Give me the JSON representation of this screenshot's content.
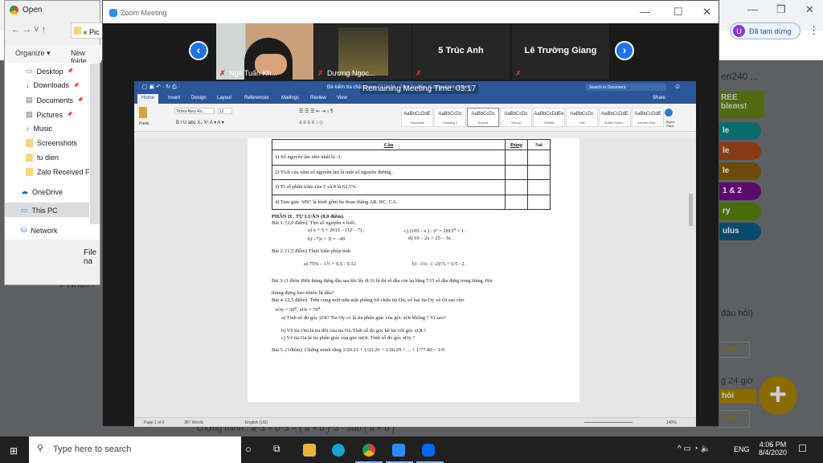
{
  "browser": {
    "profile_label": "Đã tạm dừng",
    "profile_initial": "U",
    "page_title_fragment": "en240 ...",
    "ad_lines": [
      "REE",
      "blems!"
    ],
    "pills": [
      {
        "label": "le",
        "color": "#0a6b6b"
      },
      {
        "label": "le",
        "color": "#8a3a14"
      },
      {
        "label": "le",
        "color": "#6b4a0a"
      },
      {
        "label": "1 & 2",
        "color": "#5a0a6b"
      },
      {
        "label": "ry",
        "color": "#4a6b0a"
      },
      {
        "label": "ulus",
        "color": "#0a4a6b"
      }
    ],
    "question_fragment": "đâu hỏi)",
    "reply_fragment": "c đầu",
    "time_fragment": "g 24 giờ",
    "ask_fragment": "hỏi",
    "reply_fragment2": "c đầu",
    "music_fragment": "♪ Nhạc l",
    "behind_text": "chưng minh : a^3 + b^3 = ( a + b )^3 - 3ab ( a + b )"
  },
  "open_dialog": {
    "title": "Open",
    "path": "« Pic",
    "organize": "Organize ▾",
    "new_folder": "New folde",
    "items": [
      "Desktop",
      "Downloads",
      "Documents",
      "Pictures",
      "Music",
      "Screenshots",
      "tu dien",
      "Zalo Received Fi"
    ],
    "onedrive": "OneDrive",
    "this_pc": "This PC",
    "network": "Network",
    "file_name_label": "File na"
  },
  "zoom": {
    "title": "Zoom Meeting",
    "participants": [
      {
        "name": "Ngô Tuấn Kh...",
        "video": true
      },
      {
        "name": "Dương Ngọc...",
        "video": true
      },
      {
        "name": "",
        "center": "5 Trúc Anh"
      },
      {
        "name": "",
        "center": "Lê Trường Giang"
      }
    ],
    "remaining": "Remaining Meeting Time: 03:17"
  },
  "word": {
    "title": "Đề kiểm tra chất lượng T7 2020 - Tâm Trí Đức [Compatibility Mode]",
    "search_placeholder": "Search in Document",
    "tabs": [
      "Home",
      "Insert",
      "Design",
      "Layout",
      "References",
      "Mailings",
      "Review",
      "View"
    ],
    "share": "Share",
    "font": "Times New Ro...",
    "size": "12",
    "paste": "Paste",
    "styles": [
      {
        "sample": "AaBbCcDdE",
        "name": "Emphasis"
      },
      {
        "sample": "AaBbCcDc",
        "name": "Heading 1"
      },
      {
        "sample": "AaBbCcDc",
        "name": "Normal"
      },
      {
        "sample": "AaBbCcDc",
        "name": "Strong"
      },
      {
        "sample": "AaBbCcDdEe",
        "name": "Subtitle"
      },
      {
        "sample": "AaBbCcDc",
        "name": "Title"
      },
      {
        "sample": "AaBbCcDdE",
        "name": "Subtle Emph..."
      },
      {
        "sample": "AaBbCcDdE",
        "name": "Intense Emp..."
      }
    ],
    "styles_pane": "Styles Pane",
    "status": {
      "page": "Page 1 of 2",
      "words": "367 Words",
      "lang": "English (US)",
      "zoom": "140%"
    },
    "table": {
      "headers": [
        "Câu",
        "Đúng",
        "Sai"
      ],
      "rows": [
        "1) Số nguyên âm nhỏ nhất là -1.",
        "2) Tích của năm số nguyên âm là một số nguyên dương .",
        "3) Tỉ số phần trăm của 5 và 8 là 62,5% .",
        "4) Tam giác ABC là hình gồm ba đoạn thẳng AB, BC, CA."
      ]
    },
    "lines": {
      "part2": "PHẦN II . TỰ LUẬN (8,0 điểm).",
      "b1": "Bài 1. (2,0 điểm). Tìm số nguyên x biết:",
      "b1a": "a) x + 5 = 2015 – (12 – 7) .",
      "b1c": "c) (105 - x ) : 2⁵ = 2015⁰ + 1.",
      "b1b": "b) –7|x + 3| = –49",
      "b1d": "d) 10 – 2x = 25 – 3x .",
      "b2": "Bài 2. (1,5 điểm) Thực hiện phép tính",
      "b2a": "a) 75% – 1½ + 0,5 : 5/12",
      "b2b": "b) –1¼ . (–2)²/5 + 1/5 : 2 .",
      "b3": "Bài 3: (1 điểm )Một thùng đựng dầu sau khi lấy đi 16 lít thì số dầu còn lại bằng 7/15 số dầu đựng trong thùng. Hỏi",
      "b3b": "thùng đựng bao nhiêu lít dầu?",
      "b4": "Bài 4. (2,5 điểm). Trên cùng một nửa mặt phẳng bờ chứa tia Ox, vẽ hai tia Oy và Ot sao cho",
      "b4x": "xOy = 30⁰, xOt = 70⁰.",
      "b4a": "a) Tính số đo góc yOt? Tia Oy có là tia phân giác của góc xOt không ? Vì sao?",
      "b4b": "b) Vẽ tia Om là tia đối của tia Ox.Tính số đo góc kề bù với góc xOt ?",
      "b4c": "c) Vẽ tia Oa là tia phân giác của góc mOt. Tính số đo góc aOy ?",
      "b5": "Bài 5. (1điểm). Chứng minh rằng 1/20.23 + 1/23.26 + 1/26.29 + ... + 1/77.80 < 1/9"
    }
  },
  "taskbar": {
    "search_placeholder": "Type here to search",
    "time": "4:06 PM",
    "date": "8/4/2020",
    "lang": "ENG"
  }
}
